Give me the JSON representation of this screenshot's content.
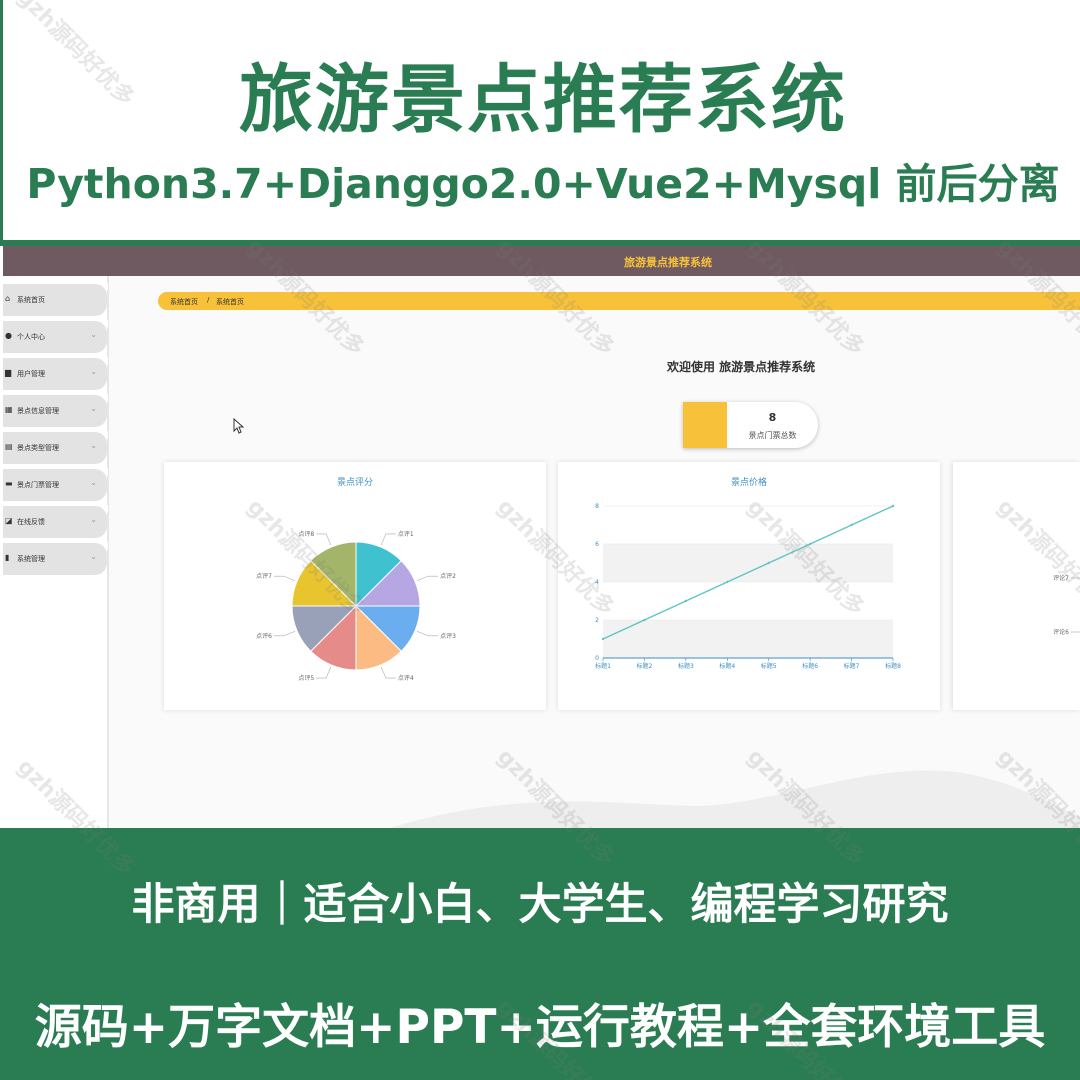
{
  "promo": {
    "title": "旅游景点推荐系统",
    "subtitle": "Python3.7+Djanggo2.0+Vue2+Mysql 前后分离",
    "line1": "非商用｜适合小白、大学生、编程学习研究",
    "line2": "源码+万字文档+PPT+运行教程+全套环境工具",
    "watermark": "gzh源码好优多"
  },
  "app": {
    "header_title": "旅游景点推荐系统",
    "breadcrumb": {
      "home": "系统首页",
      "separator": "/",
      "current": "系统首页"
    },
    "welcome": "欢迎使用 旅游景点推荐系统",
    "stat": {
      "value": "8",
      "label": "景点门票总数"
    }
  },
  "sidebar": {
    "items": [
      {
        "label": "系统首页",
        "icon": "home-icon",
        "has_chevron": false
      },
      {
        "label": "个人中心",
        "icon": "user-icon",
        "has_chevron": true
      },
      {
        "label": "用户管理",
        "icon": "book-icon",
        "has_chevron": true
      },
      {
        "label": "景点信息管理",
        "icon": "grid-icon",
        "has_chevron": true
      },
      {
        "label": "景点类型管理",
        "icon": "briefcase-icon",
        "has_chevron": true
      },
      {
        "label": "景点门票管理",
        "icon": "ticket-icon",
        "has_chevron": true
      },
      {
        "label": "在线反馈",
        "icon": "feedback-icon",
        "has_chevron": true
      },
      {
        "label": "系统管理",
        "icon": "bar-chart-icon",
        "has_chevron": true
      }
    ]
  },
  "colors": {
    "brand_green": "#2a7d52",
    "header_brown": "#6e5a60",
    "accent_yellow": "#f7c23a",
    "chart_title_blue": "#3a8ec8",
    "line_color": "#5fc4c4"
  },
  "chart_data": [
    {
      "type": "pie",
      "title": "景点评分",
      "categories": [
        "点评1",
        "点评2",
        "点评3",
        "点评4",
        "点评5",
        "点评6",
        "点评7",
        "点评8"
      ],
      "values": [
        1,
        1,
        1,
        1,
        1,
        1,
        1,
        1
      ],
      "colors": [
        "#3fc1d0",
        "#b6a6e3",
        "#6aaef0",
        "#fdbb84",
        "#e58c8a",
        "#98a1b8",
        "#e8c52e",
        "#a2b568"
      ]
    },
    {
      "type": "line",
      "title": "景点价格",
      "categories": [
        "标题1",
        "标题2",
        "标题3",
        "标题4",
        "标题5",
        "标题6",
        "标题7",
        "标题8"
      ],
      "values": [
        1,
        2,
        3,
        4,
        5,
        6,
        7,
        8
      ],
      "ylim": [
        0,
        8
      ],
      "yticks": [
        0,
        2,
        4,
        6,
        8
      ]
    },
    {
      "type": "pie",
      "title": "",
      "categories": [
        "评论7",
        "评论6"
      ],
      "values": [
        1,
        1
      ]
    }
  ]
}
